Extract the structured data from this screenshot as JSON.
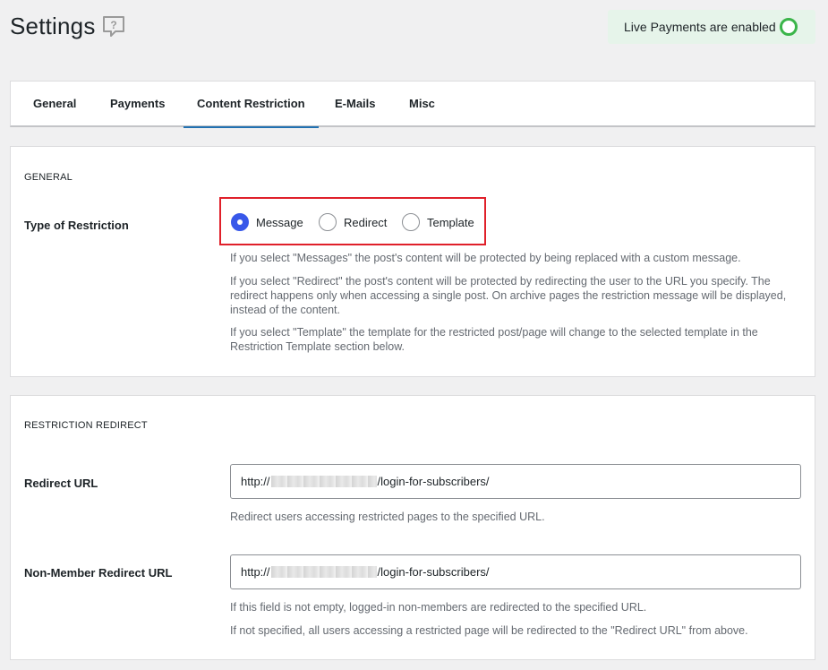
{
  "header": {
    "title": "Settings",
    "help_icon": "question-mark-speech-icon",
    "live_badge": "Live Payments are enabled",
    "live_status_color": "#3bb54a"
  },
  "tabs": [
    {
      "label": "General"
    },
    {
      "label": "Payments"
    },
    {
      "label": "Content Restriction",
      "active": true
    },
    {
      "label": "E-Mails"
    },
    {
      "label": "Misc"
    }
  ],
  "general": {
    "section_title": "GENERAL",
    "type_label": "Type of Restriction",
    "options": [
      {
        "label": "Message",
        "checked": true
      },
      {
        "label": "Redirect",
        "checked": false
      },
      {
        "label": "Template",
        "checked": false
      }
    ],
    "descriptions": [
      "If you select \"Messages\" the post's content will be protected by being replaced with a custom message.",
      "If you select \"Redirect\" the post's content will be protected by redirecting the user to the URL you specify. The redirect happens only when accessing a single post. On archive pages the restriction message will be displayed, instead of the content.",
      "If you select \"Template\" the template for the restricted post/page will change to the selected template in the Restriction Template section below."
    ]
  },
  "redirect": {
    "section_title": "RESTRICTION REDIRECT",
    "redirect_url_label": "Redirect URL",
    "redirect_url_prefix": "http://",
    "redirect_url_suffix": "/login-for-subscribers/",
    "redirect_url_desc": "Redirect users accessing restricted pages to the specified URL.",
    "nonmember_label": "Non-Member Redirect URL",
    "nonmember_prefix": "http://",
    "nonmember_suffix": "/login-for-subscribers/",
    "nonmember_desc_1": "If this field is not empty, logged-in non-members are redirected to the specified URL.",
    "nonmember_desc_2": "If not specified, all users accessing a restricted page will be redirected to the \"Redirect URL\" from above."
  },
  "colors": {
    "accent": "#3858e9",
    "tab_active": "#2271b1",
    "highlight_box": "#e0202a"
  }
}
